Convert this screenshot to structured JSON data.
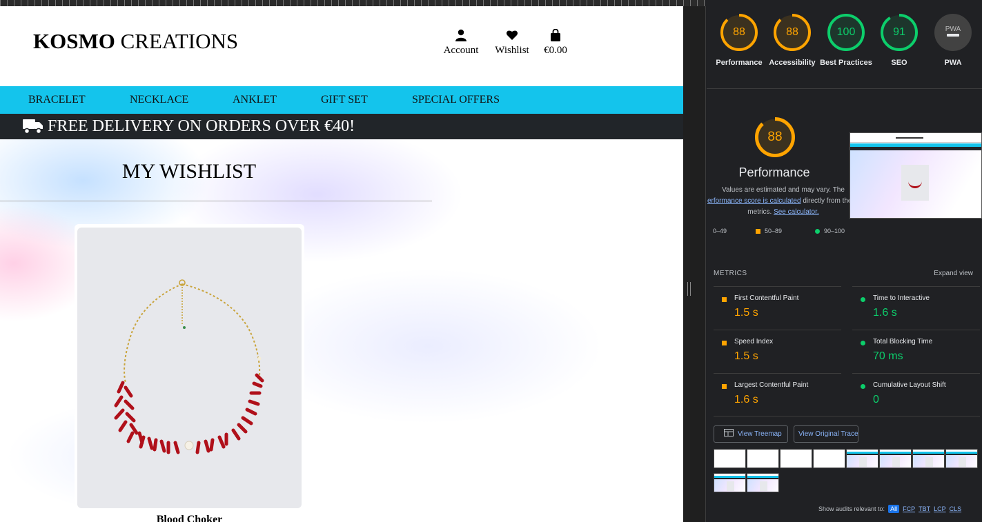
{
  "site": {
    "logo_bold": "KOSMO",
    "logo_rest": " CREATIONS",
    "header_icons": [
      {
        "icon": "user-icon",
        "label": "Account"
      },
      {
        "icon": "heart-icon",
        "label": "Wishlist"
      },
      {
        "icon": "shopping-bag-icon",
        "label": "€0.00"
      }
    ],
    "nav": [
      "BRACELET",
      "NECKLACE",
      "ANKLET",
      "GIFT SET",
      "SPECIAL OFFERS"
    ],
    "nav_color": "#14c4ec",
    "delivery_banner": "FREE DELIVERY ON ORDERS OVER €40!",
    "page_title": "MY WISHLIST",
    "product": {
      "title": "Blood Choker",
      "image": "red-coral-necklace"
    }
  },
  "lighthouse": {
    "scores": [
      {
        "value": "88",
        "label": "Performance",
        "status": "average"
      },
      {
        "value": "88",
        "label": "Accessibility",
        "status": "average"
      },
      {
        "value": "100",
        "label": "Best Practices",
        "status": "pass"
      },
      {
        "value": "91",
        "label": "SEO",
        "status": "pass"
      },
      {
        "value": "PWA",
        "label": "PWA",
        "status": "na"
      }
    ],
    "performance": {
      "score": "88",
      "title": "Performance",
      "desc_1": "Values are estimated and may vary. The",
      "desc_link_1": "erformance score is calculated",
      "desc_2": " directly from these",
      "desc_3": "metrics. ",
      "desc_link_2": "See calculator."
    },
    "legend": [
      "0–49",
      "50–89",
      "90–100"
    ],
    "metrics_label": "METRICS",
    "expand_view": "Expand view",
    "metrics": [
      {
        "name": "First Contentful Paint",
        "value": "1.5 s",
        "status": "average"
      },
      {
        "name": "Time to Interactive",
        "value": "1.6 s",
        "status": "pass"
      },
      {
        "name": "Speed Index",
        "value": "1.5 s",
        "status": "average"
      },
      {
        "name": "Total Blocking Time",
        "value": "70 ms",
        "status": "pass"
      },
      {
        "name": "Largest Contentful Paint",
        "value": "1.6 s",
        "status": "average"
      },
      {
        "name": "Cumulative Layout Shift",
        "value": "0",
        "status": "pass"
      }
    ],
    "buttons": {
      "treemap": "View Treemap",
      "trace": "View Original Trace"
    },
    "audits_label": "Show audits relevant to:",
    "audit_filters": [
      "All",
      "FCP",
      "TBT",
      "LCP",
      "CLS"
    ],
    "colors": {
      "average": "#ffa400",
      "pass": "#0cce6b",
      "na": "#9aa0a6"
    }
  }
}
